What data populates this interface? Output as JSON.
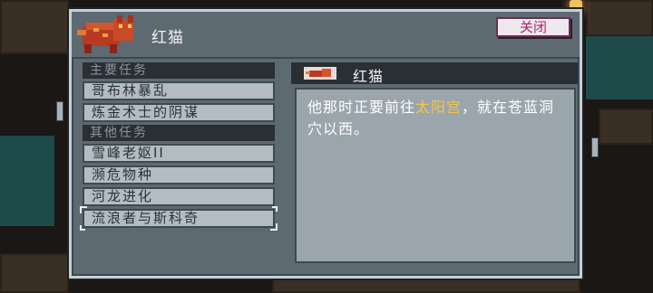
{
  "header": {
    "title": "红猫",
    "close_label": "关闭"
  },
  "quest_list": {
    "main_header": "主要任务",
    "main_items": [
      "哥布林暴乱",
      "炼金术士的阴谋"
    ],
    "other_header": "其他任务",
    "other_items": [
      "雪峰老妪II",
      "濒危物种",
      "河龙进化",
      "流浪者与斯科奇"
    ]
  },
  "detail": {
    "title": "红猫",
    "text_before": "他那时正要前往",
    "text_highlight": "太阳宫",
    "text_after": "，就在苍蓝洞穴以西。"
  },
  "colors": {
    "highlight": "#f5c44a",
    "close_text": "#b0226a",
    "panel": "#5d6a72"
  },
  "icons": {
    "portrait": "red-cat-icon",
    "detail": "red-cat-small-icon"
  }
}
